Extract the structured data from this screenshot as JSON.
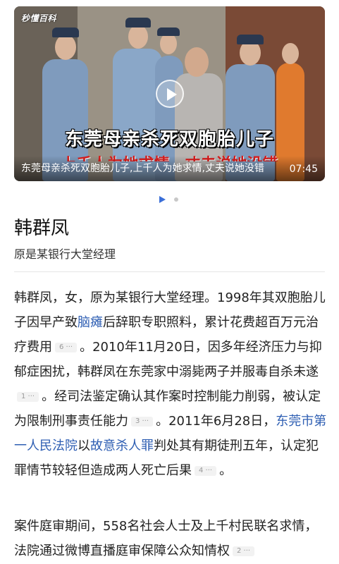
{
  "video": {
    "logo": "秒懂百科",
    "headline": "东莞母亲杀死双胞胎儿子",
    "subline": "上千人为她求情，丈夫说她没错",
    "caption": "东莞母亲杀死双胞胎儿子,上千人为她求情,丈夫说她没错",
    "duration": "07:45"
  },
  "carousel": {
    "active": 0,
    "count": 2
  },
  "entry": {
    "title": "韩群凤",
    "subtitle": "原是某银行大堂经理"
  },
  "para1": {
    "t1": "韩群凤，女，原为某银行大堂经理。1998年其双胞胎儿子因早产致",
    "link1": "脑瘫",
    "t2": "后辞职专职照料，累计花费超百万元治疗费用",
    "ref1": "6 ···",
    "t3": "。2010年11月20日，因多年经济压力与抑郁症困扰，韩群凤在东莞家中溺毙两子并服毒自杀未遂",
    "ref2": "1 ···",
    "t4": "。经司法鉴定确认其作案时控制能力削弱，被认定为限制刑事责任能力",
    "ref3": "3 ···",
    "t5": "。2011年6月28日，",
    "link2": "东莞市第一人民法院",
    "t6": "以",
    "link3": "故意杀人罪",
    "t7": "判处其有期徒刑五年，认定犯罪情节较轻但造成两人死亡后果",
    "ref4": "4 ···",
    "t8": "。"
  },
  "para2": {
    "t1": "案件庭审期间，558名社会人士及上千村民联名求情，法院通过微博直播庭审保障公众知情权",
    "ref1": "2 ···"
  },
  "colors": {
    "link": "#2f5fb3",
    "carousel_active": "#3b6fd8",
    "subline_red": "#d81e1e"
  },
  "icons": {
    "play": "play-icon"
  }
}
